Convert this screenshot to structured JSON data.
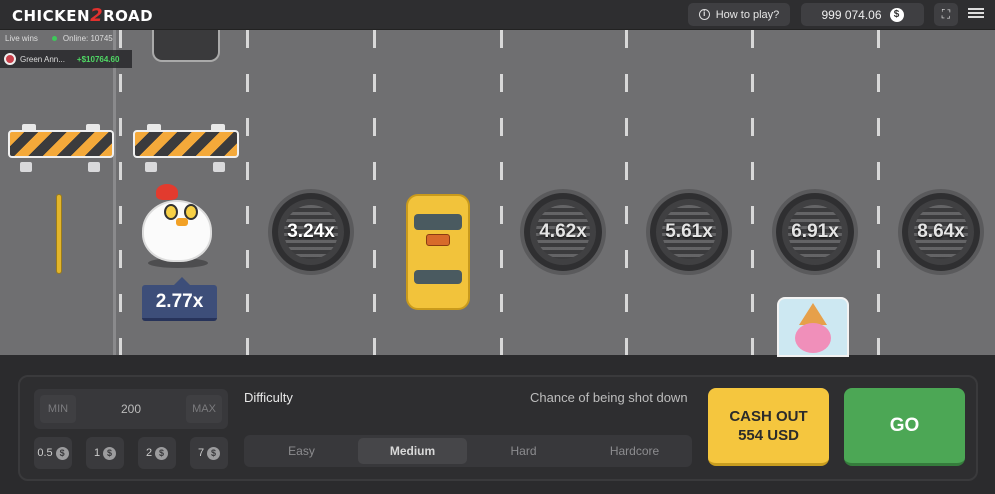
{
  "header": {
    "logo_left": "CHICKEN",
    "logo_mid": "2",
    "logo_right": "ROAD",
    "how_to_play": "How to play?",
    "balance": "999 074.06",
    "currency_symbol": "$"
  },
  "live": {
    "title": "Live wins",
    "online_label": "Online: 10745",
    "winner_name": "Green Ann...",
    "winner_amount": "+$10764.60"
  },
  "road": {
    "current_multiplier": "2.77x",
    "multipliers": [
      "3.24x",
      "4.62x",
      "5.61x",
      "6.91x",
      "8.64x"
    ]
  },
  "bet": {
    "min_label": "MIN",
    "value": "200",
    "max_label": "MAX",
    "chips": [
      "0.5",
      "1",
      "2",
      "7"
    ]
  },
  "difficulty": {
    "label": "Difficulty",
    "chance_label": "Chance of being shot down",
    "options": [
      "Easy",
      "Medium",
      "Hard",
      "Hardcore"
    ],
    "selected": "Medium"
  },
  "actions": {
    "cashout_line1": "CASH OUT",
    "cashout_line2": "554 USD",
    "go_label": "GO"
  },
  "colors": {
    "road": "#6f6f71",
    "cashout": "#f5c63e",
    "go": "#4ca755",
    "multiplier_badge": "#3d4e79"
  }
}
